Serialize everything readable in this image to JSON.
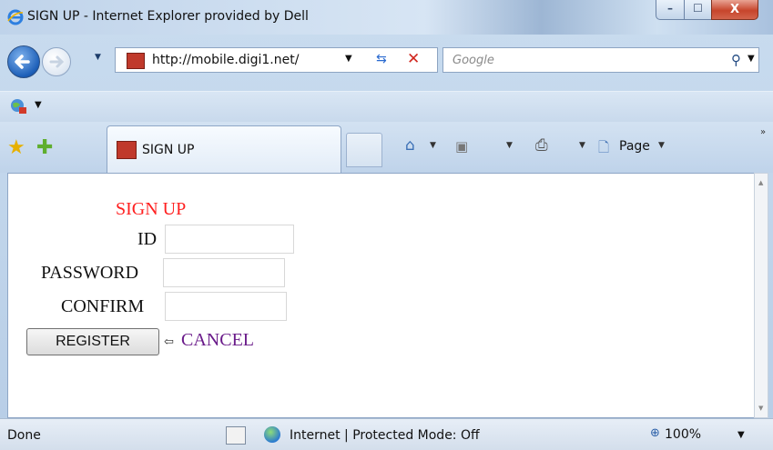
{
  "window": {
    "title": "SIGN UP - Internet Explorer provided by Dell",
    "minimize": "–",
    "maximize": "☐",
    "close": "X"
  },
  "navigation": {
    "address": "http://mobile.digi1.net/",
    "search_placeholder": "Google"
  },
  "tabs": {
    "active_label": "SIGN UP"
  },
  "command_bar": {
    "page_label": "Page"
  },
  "form": {
    "heading": "SIGN UP",
    "id_label": "ID",
    "password_label": "PASSWORD",
    "confirm_label": "CONFIRM",
    "id_value": "",
    "password_value": "",
    "confirm_value": "",
    "register_button": "REGISTER",
    "cancel_link": "CANCEL"
  },
  "status": {
    "text": "Done",
    "zone": "Internet | Protected Mode: Off",
    "zoom": "100%"
  },
  "colors": {
    "heading": "#ff2020",
    "cancel_link": "#6a1b8a"
  },
  "icons": [
    "ie-logo-icon",
    "back-arrow-icon",
    "forward-arrow-icon",
    "refresh-icon",
    "stop-icon",
    "search-icon",
    "favorites-star-icon",
    "add-favorite-icon",
    "home-icon",
    "feeds-icon",
    "print-icon",
    "page-icon",
    "cancel-arrow-icon",
    "globe-icon"
  ]
}
